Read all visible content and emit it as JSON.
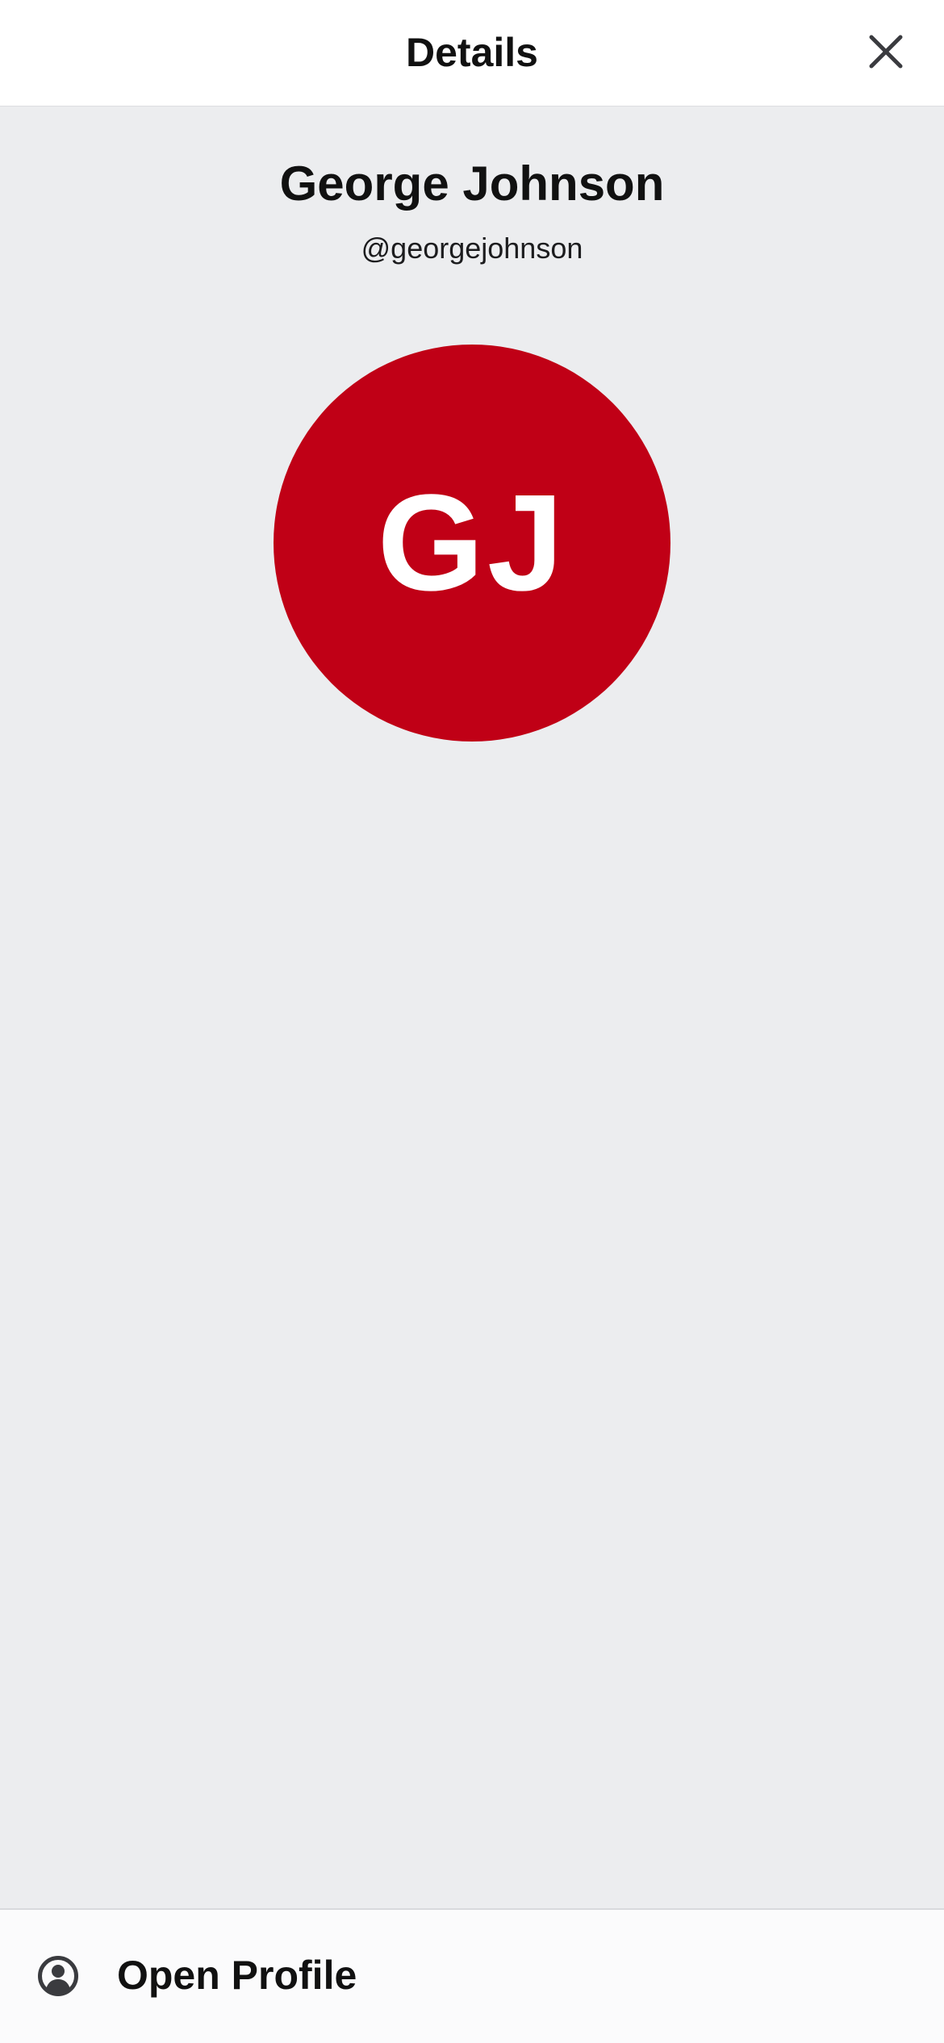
{
  "header": {
    "title": "Details",
    "close_icon": "close-icon"
  },
  "profile": {
    "name": "George Johnson",
    "handle": "@georgejohnson",
    "avatar_initials": "GJ",
    "avatar_color": "#c00016"
  },
  "actions": {
    "open_profile_label": "Open Profile",
    "open_profile_icon": "user-circle-icon"
  },
  "colors": {
    "background": "#ecedef",
    "header_background": "#ffffff",
    "text_primary": "#111111",
    "icon": "#3a3b3f"
  }
}
